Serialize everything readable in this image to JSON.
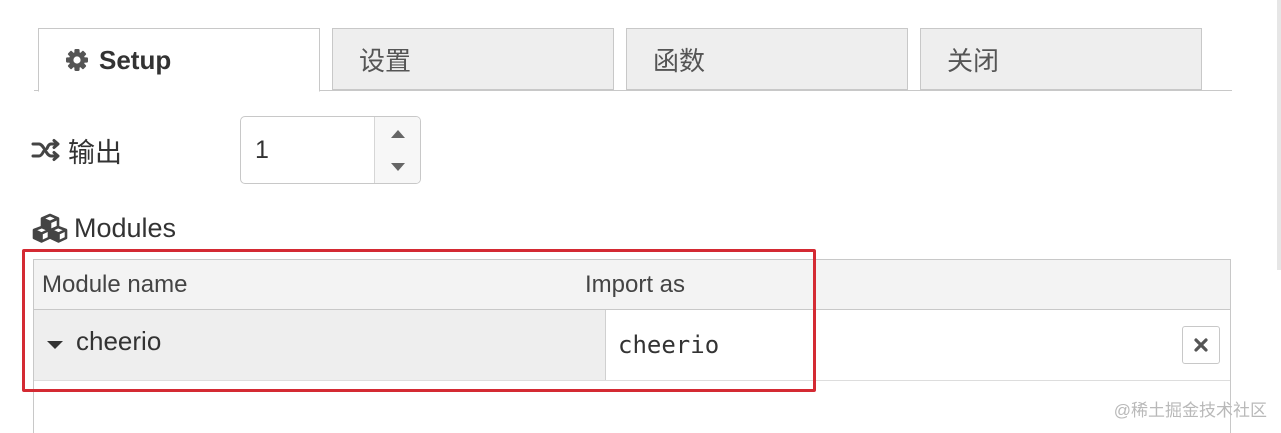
{
  "tabs": [
    {
      "label": "Setup",
      "icon": "gear-icon",
      "active": true
    },
    {
      "label": "设置",
      "active": false
    },
    {
      "label": "函数",
      "active": false
    },
    {
      "label": "关闭",
      "active": false
    }
  ],
  "outputs": {
    "label": "输出",
    "icon": "shuffle-icon",
    "value": "1"
  },
  "modules": {
    "label": "Modules",
    "icon": "cubes-icon",
    "columns": [
      "Module name",
      "Import as"
    ],
    "rows": [
      {
        "module": "cheerio",
        "import_as": "cheerio"
      }
    ]
  },
  "watermark": "@稀土掘金技术社区",
  "colors": {
    "highlight": "#d42a33",
    "tab_bg": "#eeeeee",
    "border": "#c8c8c8"
  }
}
